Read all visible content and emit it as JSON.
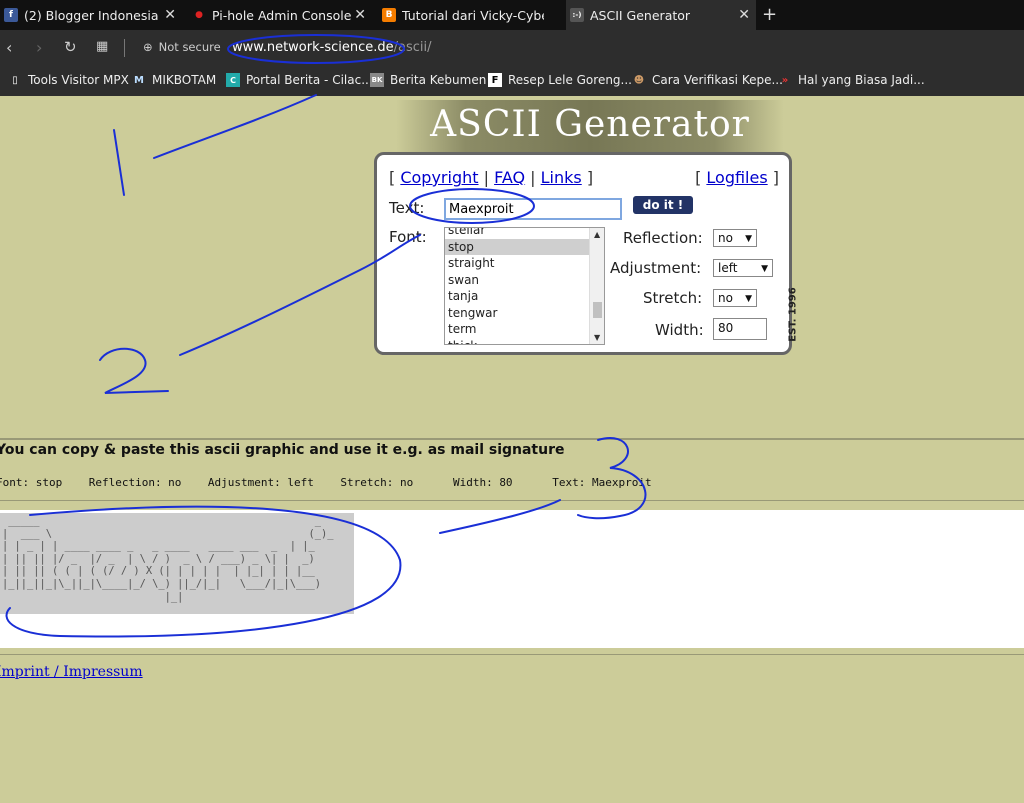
{
  "browser": {
    "tabs": [
      {
        "label": "(2) Blogger Indonesia",
        "icon": "facebook-icon",
        "color": "#3b5998",
        "glyph": "f"
      },
      {
        "label": "Pi-hole Admin Console",
        "icon": "pihole-icon",
        "color": "#cc2222",
        "glyph": "🍓"
      },
      {
        "label": "Tutorial dari Vicky-Cyber: C",
        "icon": "blogger-icon",
        "color": "#f57d00",
        "glyph": "B"
      },
      {
        "label": "ASCII Generator",
        "icon": "ascii-icon",
        "color": "#444444",
        "glyph": ":-)"
      }
    ],
    "nav": {
      "secure_label": "Not secure",
      "url_host": "www.network-science.de",
      "url_path": "/ascii/"
    },
    "bookmarks": [
      {
        "label": "Tools Visitor MPX",
        "icon": "page-icon"
      },
      {
        "label": "MIKBOTAM",
        "icon": "m-icon"
      },
      {
        "label": "Portal Berita - Cilac...",
        "icon": "portal-icon"
      },
      {
        "label": "Berita Kebumen",
        "icon": "bk-icon"
      },
      {
        "label": "Resep Lele Goreng...",
        "icon": "f-icon"
      },
      {
        "label": "Cara Verifikasi Kepe...",
        "icon": "avatar-icon"
      },
      {
        "label": "Hal yang Biasa Jadi...",
        "icon": "chevrons-icon"
      }
    ]
  },
  "page": {
    "logo_text": "ASCII Generator",
    "links": {
      "copyright": "Copyright",
      "faq": "FAQ",
      "links": "Links",
      "logfiles": "Logfiles"
    },
    "form": {
      "text_label": "Text:",
      "text_value": "Maexproit",
      "doit_label": "do it !",
      "font_label": "Font:",
      "fonts": [
        "stellar",
        "stop",
        "straight",
        "swan",
        "tanja",
        "tengwar",
        "term",
        "thick"
      ],
      "selected_font": "stop",
      "reflection_label": "Reflection:",
      "reflection_value": "no",
      "adjustment_label": "Adjustment:",
      "adjustment_value": "left",
      "stretch_label": "Stretch:",
      "stretch_value": "no",
      "width_label": "Width:",
      "width_value": "80"
    },
    "est": "EST. 1996",
    "copy_hint": "You can copy & paste this ascii graphic and use it e.g. as mail signature",
    "info_line": "Font: stop    Reflection: no    Adjustment: left    Stretch: no      Width: 80      Text: Maexproit",
    "ascii_art": " _____                                            _   \n|  ___ \\                                         (_)_ \n| | _ | | ____ ____ _   _ ____   ____ ___  _  | |_ \n| || || |/ _  |/ _  | \\ / )  _ \\ / ___) _ \\| |  _)\n| || || ( ( | ( (/ / ) X (| | | | |  | |_| | | |__ \n|_||_||_|\\_||_|\\____|_/ \\_) ||_/|_|   \\___/|_|\\___)\n                          |_|",
    "imprint": "Imprint / Impressum"
  }
}
